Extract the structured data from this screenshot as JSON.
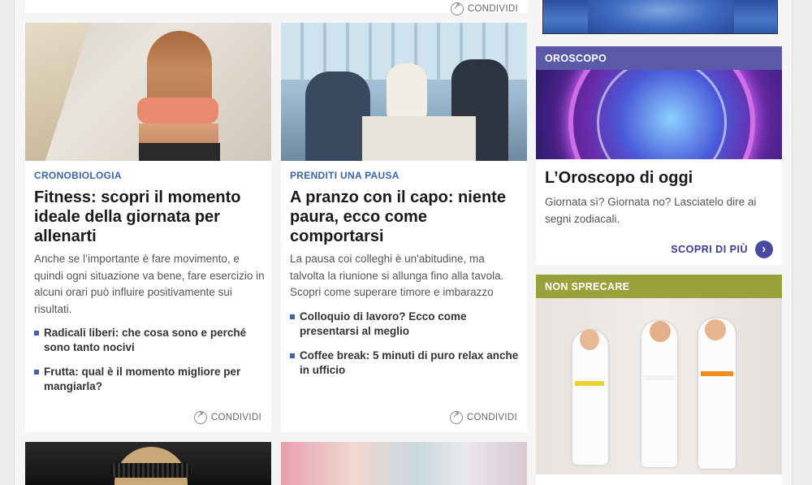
{
  "top": {
    "share_label": "CONDIVIDI"
  },
  "cards": [
    {
      "category": "CRONOBIOLOGIA",
      "title": "Fitness: scopri il momento ideale della giornata per allenarti",
      "description": "Anche se l’importante è fare movimento, e quindi ogni situazione va bene, fare esercizio in alcuni orari può influire positivamente sui risultati.",
      "links": [
        "Radicali liberi: che cosa sono e perché sono tanto nocivi",
        "Frutta: qual è il momento migliore per mangiarla?"
      ],
      "share_label": "CONDIVIDI"
    },
    {
      "category": "PRENDITI UNA PAUSA",
      "title": "A pranzo con il capo: niente paura, ecco come comportarsi",
      "description": "La pausa coi colleghi è un'abitudine, ma talvolta la riunione si allunga fino alla tavola. Scopri come superare timore e imbarazzo",
      "links": [
        "Colloquio di lavoro? Ecco come presentarsi al meglio",
        "Coffee break: 5 minuti di puro relax anche in ufficio"
      ],
      "share_label": "CONDIVIDI"
    }
  ],
  "sidebar": {
    "horoscope": {
      "header": "OROSCOPO",
      "title": "L’Oroscopo di oggi",
      "description": "Giornata sì? Giornata no? Lasciatelo dire ai segni zodiacali.",
      "cta_label": "SCOPRI DI PIÙ",
      "header_color": "#5a5aa8"
    },
    "non_sprecare": {
      "header": "NON SPRECARE",
      "header_color": "#9aa03a"
    }
  }
}
